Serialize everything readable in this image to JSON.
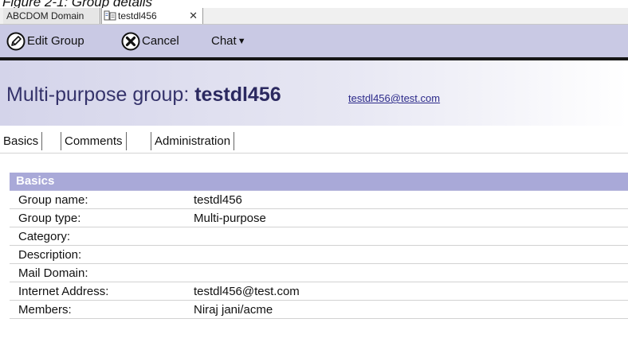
{
  "caption": "Figure 2-1: Group details",
  "window_tabs": [
    {
      "label": "ABCDOM Domain"
    },
    {
      "label": "testdl456"
    }
  ],
  "toolbar": {
    "edit_label": "Edit Group",
    "cancel_label": "Cancel",
    "chat_label": "Chat"
  },
  "header": {
    "prefix": "Multi-purpose group: ",
    "name": "testdl456",
    "email": "testdl456@test.com"
  },
  "subtabs": [
    "Basics",
    "Comments",
    "Administration"
  ],
  "section": {
    "title": "Basics",
    "fields": [
      {
        "label": "Group name:",
        "value": "testdl456"
      },
      {
        "label": "Group type:",
        "value": "Multi-purpose"
      },
      {
        "label": "Category:",
        "value": ""
      },
      {
        "label": "Description:",
        "value": ""
      },
      {
        "label": "Mail Domain:",
        "value": ""
      },
      {
        "label": "Internet Address:",
        "value": "testdl456@test.com"
      },
      {
        "label": "Members:",
        "value": "Niraj jani/acme"
      }
    ]
  },
  "colors": {
    "toolbar_bg": "#c9c9e4",
    "section_header_bg": "#a9a9d8",
    "title_color": "#35336b",
    "link_color": "#2c2a8a"
  },
  "icons": [
    "document-icon",
    "close-icon",
    "edit-icon",
    "cancel-icon",
    "chevron-down-icon"
  ]
}
